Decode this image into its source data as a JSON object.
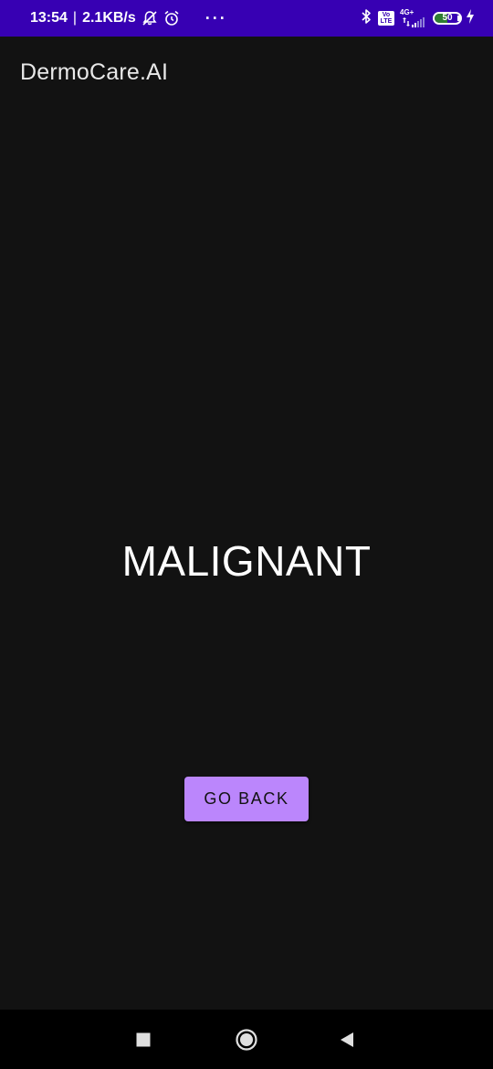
{
  "status_bar": {
    "time": "13:54",
    "separator": "|",
    "data_rate": "2.1KB/s",
    "more_indicator": "···",
    "volte_top": "Vo",
    "volte_bottom": "LTE",
    "network_type": "4G+",
    "battery_level": "50",
    "icons": [
      "bell-off-icon",
      "alarm-icon",
      "bluetooth-icon",
      "volte-icon",
      "signal-icon",
      "battery-icon",
      "charging-icon"
    ],
    "colors": {
      "background": "#3700b3",
      "battery_fill": "#2e7d32"
    }
  },
  "app_bar": {
    "title": "DermoCare.AI"
  },
  "result": {
    "label": "MALIGNANT"
  },
  "actions": {
    "go_back_label": "GO BACK"
  },
  "nav_bar": {
    "icons": [
      "recents-icon",
      "home-icon",
      "back-icon"
    ]
  },
  "colors": {
    "background": "#121212",
    "accent": "#bb86fc",
    "text": "#ffffff"
  }
}
